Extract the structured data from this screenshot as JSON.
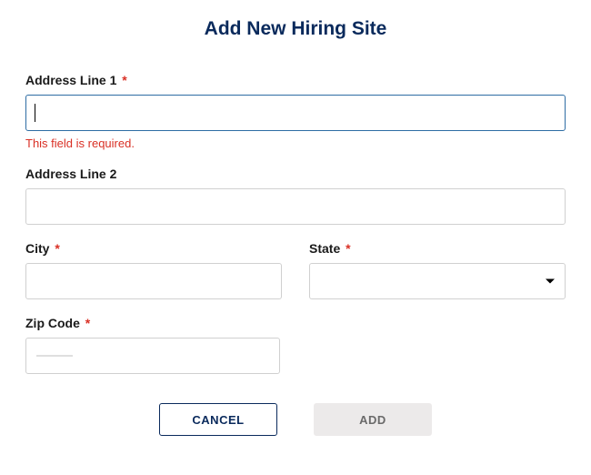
{
  "title": "Add New Hiring Site",
  "fields": {
    "address1": {
      "label": "Address Line 1",
      "required_mark": "*",
      "value": "",
      "error": "This field is required."
    },
    "address2": {
      "label": "Address Line 2",
      "value": ""
    },
    "city": {
      "label": "City",
      "required_mark": "*",
      "value": ""
    },
    "state": {
      "label": "State",
      "required_mark": "*",
      "selected": ""
    },
    "zip": {
      "label": "Zip Code",
      "required_mark": "*",
      "value": ""
    }
  },
  "buttons": {
    "cancel": "CANCEL",
    "add": "ADD"
  }
}
